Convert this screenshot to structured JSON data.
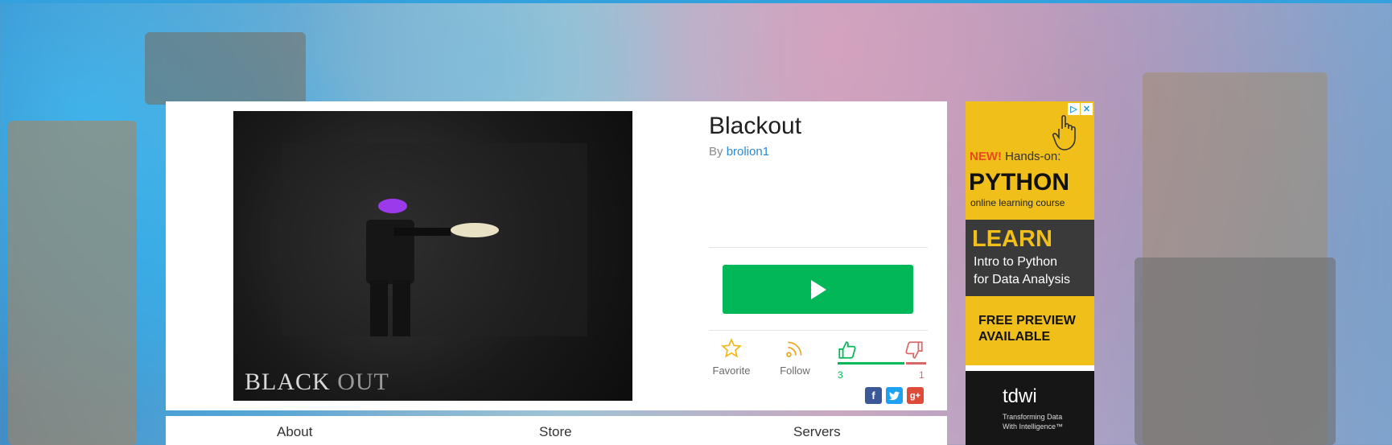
{
  "game": {
    "title": "Blackout",
    "by_label": "By",
    "creator": "brolion1",
    "thumbnail_title_a": "BLACK",
    "thumbnail_title_b": "OUT"
  },
  "actions": {
    "favorite_label": "Favorite",
    "follow_label": "Follow",
    "upvotes": "3",
    "downvotes": "1",
    "vote_ratio": 0.75
  },
  "tabs": [
    "About",
    "Store",
    "Servers"
  ],
  "ad": {
    "new_label": "NEW!",
    "hands_on": "Hands-on:",
    "python": "PYTHON",
    "course": "online learning course",
    "learn": "LEARN",
    "intro_line1": "Intro to Python",
    "intro_line2": "for Data Analysis",
    "preview_line1": "FREE PREVIEW",
    "preview_line2": "AVAILABLE",
    "brand": "tdwi",
    "brand_tag1": "Transforming Data",
    "brand_tag2": "With Intelligence™"
  },
  "colors": {
    "play": "#02b757",
    "link": "#2a8ad6",
    "favorite": "#f2b81a",
    "follow": "#e7a826",
    "upvote": "#02b757",
    "downvote": "#d86868",
    "facebook": "#3b5998",
    "twitter": "#1da1f2",
    "google": "#dd4b39"
  }
}
